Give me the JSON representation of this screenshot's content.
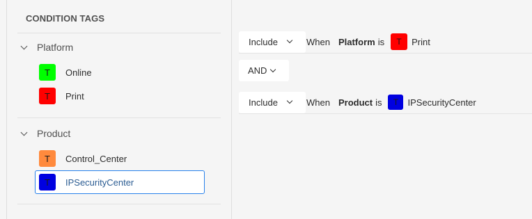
{
  "panel": {
    "title": "CONDITION TAGS",
    "groups": [
      {
        "name": "Platform",
        "items": [
          {
            "label": "Online",
            "color": "#00ff00",
            "letter": "T"
          },
          {
            "label": "Print",
            "color": "#ff0000",
            "letter": "T"
          }
        ]
      },
      {
        "name": "Product",
        "items": [
          {
            "label": "Control_Center",
            "color": "#ff8a3d",
            "letter": "T"
          },
          {
            "label": "IPSecurityCenter",
            "color": "#0000e0",
            "letter": "T",
            "selected": true
          }
        ]
      }
    ]
  },
  "rules": [
    {
      "mode": "Include",
      "when": "When",
      "field": "Platform",
      "is": "is",
      "tag": "Print",
      "tag_color": "#ff0000",
      "tag_letter": "T"
    },
    {
      "mode": "Include",
      "when": "When",
      "field": "Product",
      "is": "is",
      "tag": "IPSecurityCenter",
      "tag_color": "#0000e0",
      "tag_letter": "T"
    }
  ],
  "operator": "AND",
  "colors": {
    "selection_border": "#2680eb",
    "background": "#f5f5f5"
  }
}
